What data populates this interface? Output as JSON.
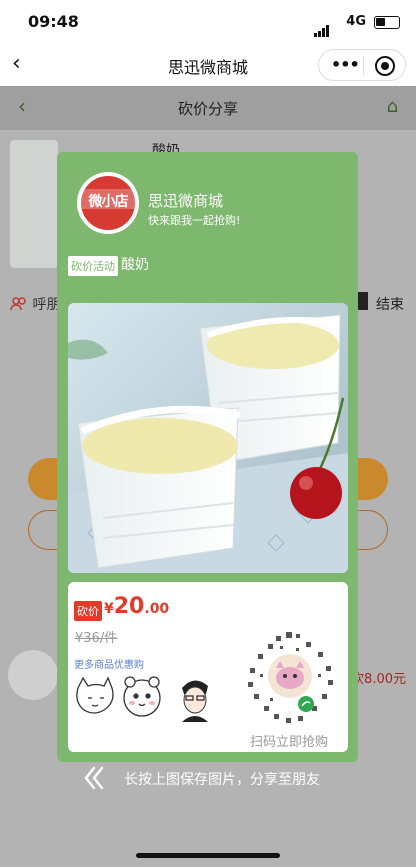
{
  "status_bar": {
    "time": "09:48",
    "network": "4G",
    "battery_level": 0.45
  },
  "nav": {
    "title": "思迅微商城"
  },
  "background_page": {
    "title": "砍价分享",
    "product_name": "酸奶",
    "call_text": "呼朋",
    "end_text": "结束",
    "side_price": "砍8.00元"
  },
  "share_card": {
    "logo_text": "微小店",
    "shop_name": "思迅微商城",
    "slogan": "快来跟我一起抢购!",
    "activity_tag": "砍价活动",
    "product_name": "酸奶",
    "price_tag": "砍价",
    "currency": "¥",
    "price_int": "20",
    "price_dec": ".00",
    "original_price": "¥36/件",
    "more_link": "更多商品优惠购",
    "qr_cta": "扫码立即抢购"
  },
  "hint": "长按上图保存图片，分享至朋友",
  "colors": {
    "card": "#7eb76e",
    "price": "#e13b2a",
    "link": "#5b7fcf",
    "logo_red": "#d63a32"
  }
}
